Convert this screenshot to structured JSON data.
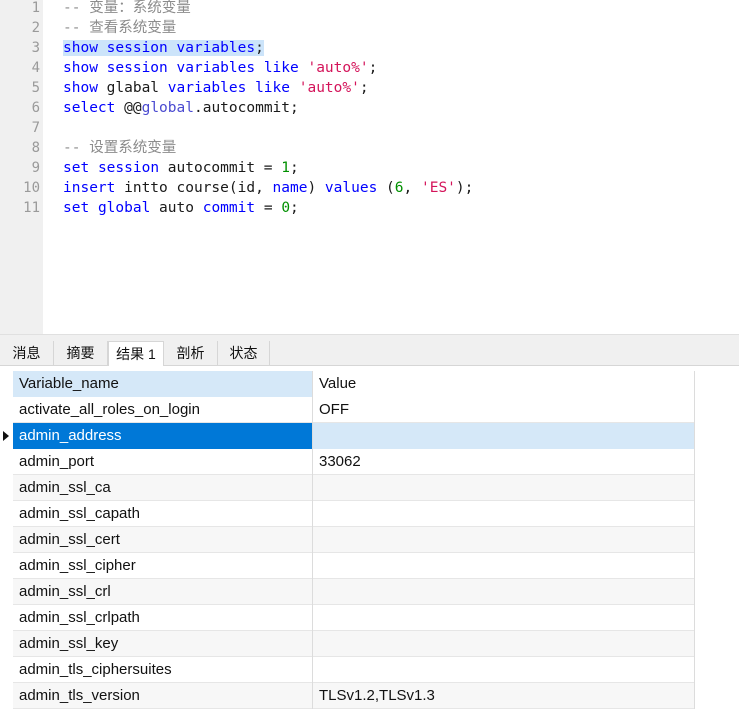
{
  "editor": {
    "lines": [
      {
        "n": "1",
        "tokens": [
          {
            "t": "-- 变量：系统变量",
            "c": "cm"
          }
        ]
      },
      {
        "n": "2",
        "tokens": [
          {
            "t": "-- 查看系统变量",
            "c": "cm"
          }
        ]
      },
      {
        "n": "3",
        "selected": true,
        "tokens": [
          {
            "t": "show",
            "c": "kw"
          },
          {
            "t": " "
          },
          {
            "t": "session",
            "c": "kw"
          },
          {
            "t": " "
          },
          {
            "t": "variables",
            "c": "kw"
          },
          {
            "t": ";"
          }
        ]
      },
      {
        "n": "4",
        "tokens": [
          {
            "t": "show",
            "c": "kw"
          },
          {
            "t": " "
          },
          {
            "t": "session",
            "c": "kw"
          },
          {
            "t": " "
          },
          {
            "t": "variables",
            "c": "kw"
          },
          {
            "t": " "
          },
          {
            "t": "like",
            "c": "kw"
          },
          {
            "t": " "
          },
          {
            "t": "'auto%'",
            "c": "str"
          },
          {
            "t": ";"
          }
        ]
      },
      {
        "n": "5",
        "tokens": [
          {
            "t": "show",
            "c": "kw"
          },
          {
            "t": " glabal "
          },
          {
            "t": "variables",
            "c": "kw"
          },
          {
            "t": " "
          },
          {
            "t": "like",
            "c": "kw"
          },
          {
            "t": " "
          },
          {
            "t": "'auto%'",
            "c": "str"
          },
          {
            "t": ";"
          }
        ]
      },
      {
        "n": "6",
        "tokens": [
          {
            "t": "select",
            "c": "kw"
          },
          {
            "t": " @@"
          },
          {
            "t": "global",
            "c": "var"
          },
          {
            "t": ".autocommit;"
          }
        ]
      },
      {
        "n": "7",
        "tokens": []
      },
      {
        "n": "8",
        "tokens": [
          {
            "t": "-- 设置系统变量",
            "c": "cm"
          }
        ]
      },
      {
        "n": "9",
        "tokens": [
          {
            "t": "set",
            "c": "kw"
          },
          {
            "t": " "
          },
          {
            "t": "session",
            "c": "kw"
          },
          {
            "t": " autocommit = "
          },
          {
            "t": "1",
            "c": "num"
          },
          {
            "t": ";"
          }
        ]
      },
      {
        "n": "10",
        "tokens": [
          {
            "t": "insert",
            "c": "kw"
          },
          {
            "t": " intto course(id, "
          },
          {
            "t": "name",
            "c": "kw"
          },
          {
            "t": ") "
          },
          {
            "t": "values",
            "c": "kw"
          },
          {
            "t": " ("
          },
          {
            "t": "6",
            "c": "num"
          },
          {
            "t": ", "
          },
          {
            "t": "'ES'",
            "c": "str"
          },
          {
            "t": ");"
          }
        ]
      },
      {
        "n": "11",
        "tokens": [
          {
            "t": "set",
            "c": "kw"
          },
          {
            "t": " "
          },
          {
            "t": "global",
            "c": "kw"
          },
          {
            "t": " auto "
          },
          {
            "t": "commit",
            "c": "kw"
          },
          {
            "t": " = "
          },
          {
            "t": "0",
            "c": "num"
          },
          {
            "t": ";"
          }
        ]
      }
    ]
  },
  "tabs": [
    {
      "label": "消息",
      "active": false
    },
    {
      "label": "摘要",
      "active": false
    },
    {
      "label": "结果 1",
      "active": true
    },
    {
      "label": "剖析",
      "active": false
    },
    {
      "label": "状态",
      "active": false
    }
  ],
  "grid": {
    "columns": [
      "Variable_name",
      "Value"
    ],
    "selected_row": 1,
    "rows": [
      [
        "activate_all_roles_on_login",
        "OFF"
      ],
      [
        "admin_address",
        ""
      ],
      [
        "admin_port",
        "33062"
      ],
      [
        "admin_ssl_ca",
        ""
      ],
      [
        "admin_ssl_capath",
        ""
      ],
      [
        "admin_ssl_cert",
        ""
      ],
      [
        "admin_ssl_cipher",
        ""
      ],
      [
        "admin_ssl_crl",
        ""
      ],
      [
        "admin_ssl_crlpath",
        ""
      ],
      [
        "admin_ssl_key",
        ""
      ],
      [
        "admin_tls_ciphersuites",
        ""
      ],
      [
        "admin_tls_version",
        "TLSv1.2,TLSv1.3"
      ]
    ]
  }
}
